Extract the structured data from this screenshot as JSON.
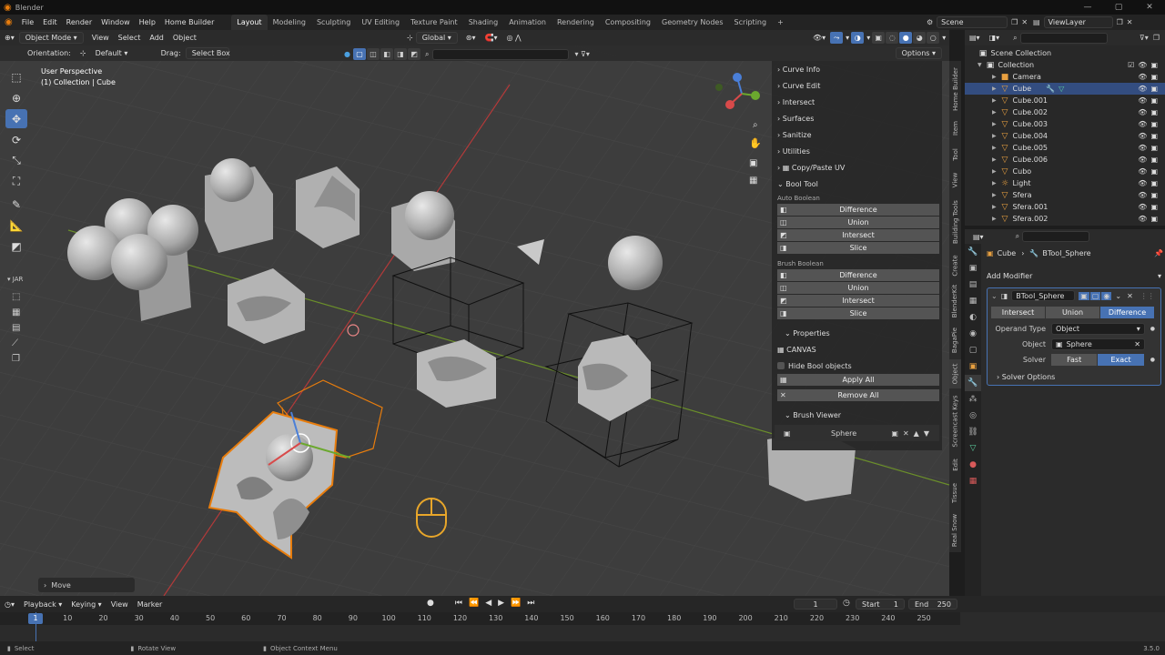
{
  "window": {
    "title": "Blender"
  },
  "menu": [
    "File",
    "Edit",
    "Render",
    "Window",
    "Help",
    "Home Builder"
  ],
  "workspaces": [
    "Layout",
    "Modeling",
    "Sculpting",
    "UV Editing",
    "Texture Paint",
    "Shading",
    "Animation",
    "Rendering",
    "Compositing",
    "Geometry Nodes",
    "Scripting"
  ],
  "active_workspace": "Layout",
  "scene": {
    "name": "Scene",
    "view_layer": "ViewLayer"
  },
  "viewport_header": {
    "mode": "Object Mode",
    "menus": [
      "View",
      "Select",
      "Add",
      "Object"
    ],
    "transform": "Global"
  },
  "tool_settings": {
    "orientation_label": "Orientation:",
    "orientation_value": "Default",
    "drag_label": "Drag:",
    "drag_value": "Select Box",
    "options": "Options"
  },
  "viewport": {
    "perspective": "User Perspective",
    "collection": "(1) Collection | Cube",
    "last_op": "Move",
    "side_label": "JAR"
  },
  "npanel": {
    "sections": [
      "Curve Info",
      "Curve Edit",
      "Intersect",
      "Surfaces",
      "Sanitize",
      "Utilities",
      "Copy/Paste UV",
      "Bool Tool"
    ],
    "auto_boolean": {
      "title": "Auto Boolean",
      "buttons": [
        "Difference",
        "Union",
        "Intersect",
        "Slice"
      ]
    },
    "brush_boolean": {
      "title": "Brush Boolean",
      "buttons": [
        "Difference",
        "Union",
        "Intersect",
        "Slice"
      ]
    },
    "properties": {
      "title": "Properties",
      "canvas": "CANVAS",
      "hide": "Hide Bool objects",
      "apply_all": "Apply All",
      "remove_all": "Remove All"
    },
    "brush_viewer": {
      "title": "Brush Viewer",
      "item": "Sphere"
    },
    "tabs": [
      "Home Builder",
      "Item",
      "Tool",
      "View",
      "Building Tools",
      "Create",
      "BlenderKit",
      "BagaPie",
      "Object",
      "Screencast Keys",
      "Edit",
      "Tissue",
      "Real Snow"
    ]
  },
  "outliner": {
    "root": "Scene Collection",
    "collection": "Collection",
    "items": [
      {
        "name": "Camera",
        "icon": "camera-icon"
      },
      {
        "name": "Cube",
        "icon": "mesh-icon",
        "selected": true
      },
      {
        "name": "Cube.001",
        "icon": "mesh-icon"
      },
      {
        "name": "Cube.002",
        "icon": "mesh-icon"
      },
      {
        "name": "Cube.003",
        "icon": "mesh-icon"
      },
      {
        "name": "Cube.004",
        "icon": "mesh-icon"
      },
      {
        "name": "Cube.005",
        "icon": "mesh-icon"
      },
      {
        "name": "Cube.006",
        "icon": "mesh-icon"
      },
      {
        "name": "Cubo",
        "icon": "mesh-icon"
      },
      {
        "name": "Light",
        "icon": "light-icon"
      },
      {
        "name": "Sfera",
        "icon": "mesh-icon"
      },
      {
        "name": "Sfera.001",
        "icon": "mesh-icon"
      },
      {
        "name": "Sfera.002",
        "icon": "mesh-icon"
      }
    ]
  },
  "properties": {
    "breadcrumb_object": "Cube",
    "breadcrumb_modifier": "BTool_Sphere",
    "add_modifier": "Add Modifier",
    "modifier_name": "BTool_Sphere",
    "operations": [
      "Intersect",
      "Union",
      "Difference"
    ],
    "active_operation": "Difference",
    "operand_type_label": "Operand Type",
    "operand_type": "Object",
    "object_label": "Object",
    "object_value": "Sphere",
    "solver_label": "Solver",
    "solvers": [
      "Fast",
      "Exact"
    ],
    "active_solver": "Exact",
    "solver_options": "Solver Options"
  },
  "timeline": {
    "menus": [
      "Playback",
      "Keying",
      "View",
      "Marker"
    ],
    "current_frame": "1",
    "start_label": "Start",
    "start": "1",
    "end_label": "End",
    "end": "250",
    "ticks": [
      "1",
      "10",
      "20",
      "30",
      "40",
      "50",
      "60",
      "70",
      "80",
      "90",
      "100",
      "110",
      "120",
      "130",
      "140",
      "150",
      "160",
      "170",
      "180",
      "190",
      "200",
      "210",
      "220",
      "230",
      "240",
      "250"
    ]
  },
  "status": {
    "left": "Select",
    "middle": "Rotate View",
    "right": "Object Context Menu",
    "version": "3.5.0"
  },
  "colors": {
    "accent": "#4772b3",
    "selection": "#e87d0d",
    "viewport_bg": "#3d3d3d"
  }
}
